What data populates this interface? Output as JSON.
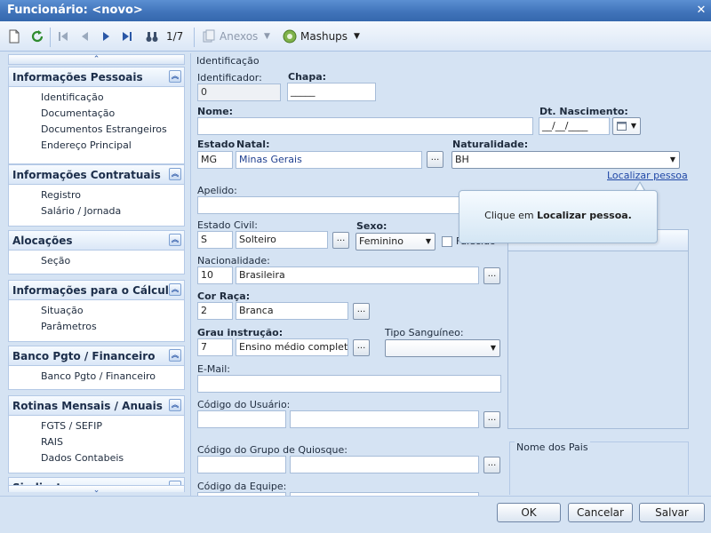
{
  "window": {
    "title": "Funcionário: <novo>",
    "close": "✕"
  },
  "toolbar": {
    "record_counter": "1/7",
    "attachments_label": "Anexos",
    "mashups_label": "Mashups"
  },
  "nav": {
    "groups": [
      {
        "title": "Informações Pessoais",
        "items": [
          "Identificação",
          "Documentação",
          "Documentos Estrangeiros",
          "Endereço Principal"
        ]
      },
      {
        "title": "Informações Contratuais",
        "items": [
          "Registro",
          "Salário / Jornada"
        ]
      },
      {
        "title": "Alocações",
        "items": [
          "Seção"
        ]
      },
      {
        "title": "Informações para o Cálculo",
        "items": [
          "Situação",
          "Parâmetros"
        ]
      },
      {
        "title": "Banco Pgto / Financeiro",
        "items": [
          "Banco Pgto / Financeiro"
        ]
      },
      {
        "title": "Rotinas Mensais / Anuais",
        "items": [
          "FGTS / SEFIP",
          "RAIS",
          "Dados Contabeis"
        ]
      },
      {
        "title": "Sindicato",
        "items": []
      }
    ]
  },
  "form": {
    "section_title": "Identificação",
    "identificador": {
      "label": "Identificador:",
      "value": "0"
    },
    "chapa": {
      "label": "Chapa:",
      "value": "_____"
    },
    "nome": {
      "label": "Nome:",
      "value": ""
    },
    "dt_nascimento": {
      "label": "Dt. Nascimento:",
      "value": "__/__/____"
    },
    "estado_natal": {
      "label1": "Estado",
      "label2": "Natal:",
      "code": "MG",
      "value": "Minas Gerais"
    },
    "naturalidade": {
      "label": "Naturalidade:",
      "value": "BH"
    },
    "localizar_pessoa": "Localizar pessoa",
    "apelido": {
      "label": "Apelido:",
      "value": ""
    },
    "estado_civil": {
      "label": "Estado Civil:",
      "code": "S",
      "value": "Solteiro"
    },
    "sexo": {
      "label": "Sexo:",
      "value": "Feminino"
    },
    "falecido_label": "Falecido",
    "nacionalidade": {
      "label": "Nacionalidade:",
      "code": "10",
      "value": "Brasileira"
    },
    "cor_raca": {
      "label": "Cor Raça:",
      "code": "2",
      "value": "Branca"
    },
    "grau_instrucao": {
      "label": "Grau instrução:",
      "code": "7",
      "value": "Ensino médio completo"
    },
    "tipo_sanguineo": {
      "label": "Tipo Sanguíneo:",
      "value": ""
    },
    "email": {
      "label": "E-Mail:",
      "value": ""
    },
    "codigo_usuario": {
      "label": "Código do Usuário:",
      "value": ""
    },
    "codigo_grupo_quiosque": {
      "label": "Código do Grupo de Quiosque:",
      "value": ""
    },
    "codigo_equipe": {
      "label": "Código da Equipe:",
      "value": ""
    },
    "nome_pais": {
      "label": "Nome dos Pais"
    }
  },
  "tooltip": {
    "prefix": "Clique em ",
    "emphasis": "Localizar pessoa."
  },
  "footer": {
    "ok_label": "OK",
    "cancel_label": "Cancelar",
    "save_label": "Salvar"
  },
  "colors": {
    "title_bar": "#3f72b9",
    "background": "#d5e3f3",
    "accent": "#1f47a6"
  }
}
